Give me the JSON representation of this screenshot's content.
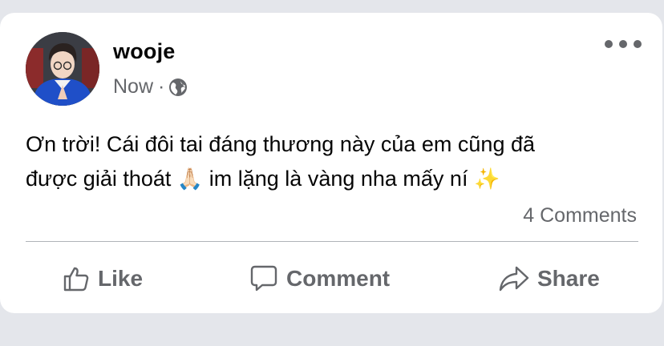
{
  "post": {
    "author": "wooje",
    "timestamp": "Now",
    "separator": "·",
    "privacy_icon": "globe-icon",
    "more_icon": "more-options-icon",
    "line1": "Ơn trời! Cái đôi tai đáng thương này của em cũng đã",
    "line2_part1": "được giải thoát ",
    "emoji_pray": "🙏🏻",
    "line2_part2": " im lặng là vàng nha mấy ní ",
    "emoji_sparkles": "✨",
    "comments_count": "4 Comments"
  },
  "actions": {
    "like_label": "Like",
    "comment_label": "Comment",
    "share_label": "Share"
  },
  "colors": {
    "background": "#e4e6eb",
    "card": "#ffffff",
    "text_primary": "#050505",
    "text_secondary": "#65676b"
  }
}
